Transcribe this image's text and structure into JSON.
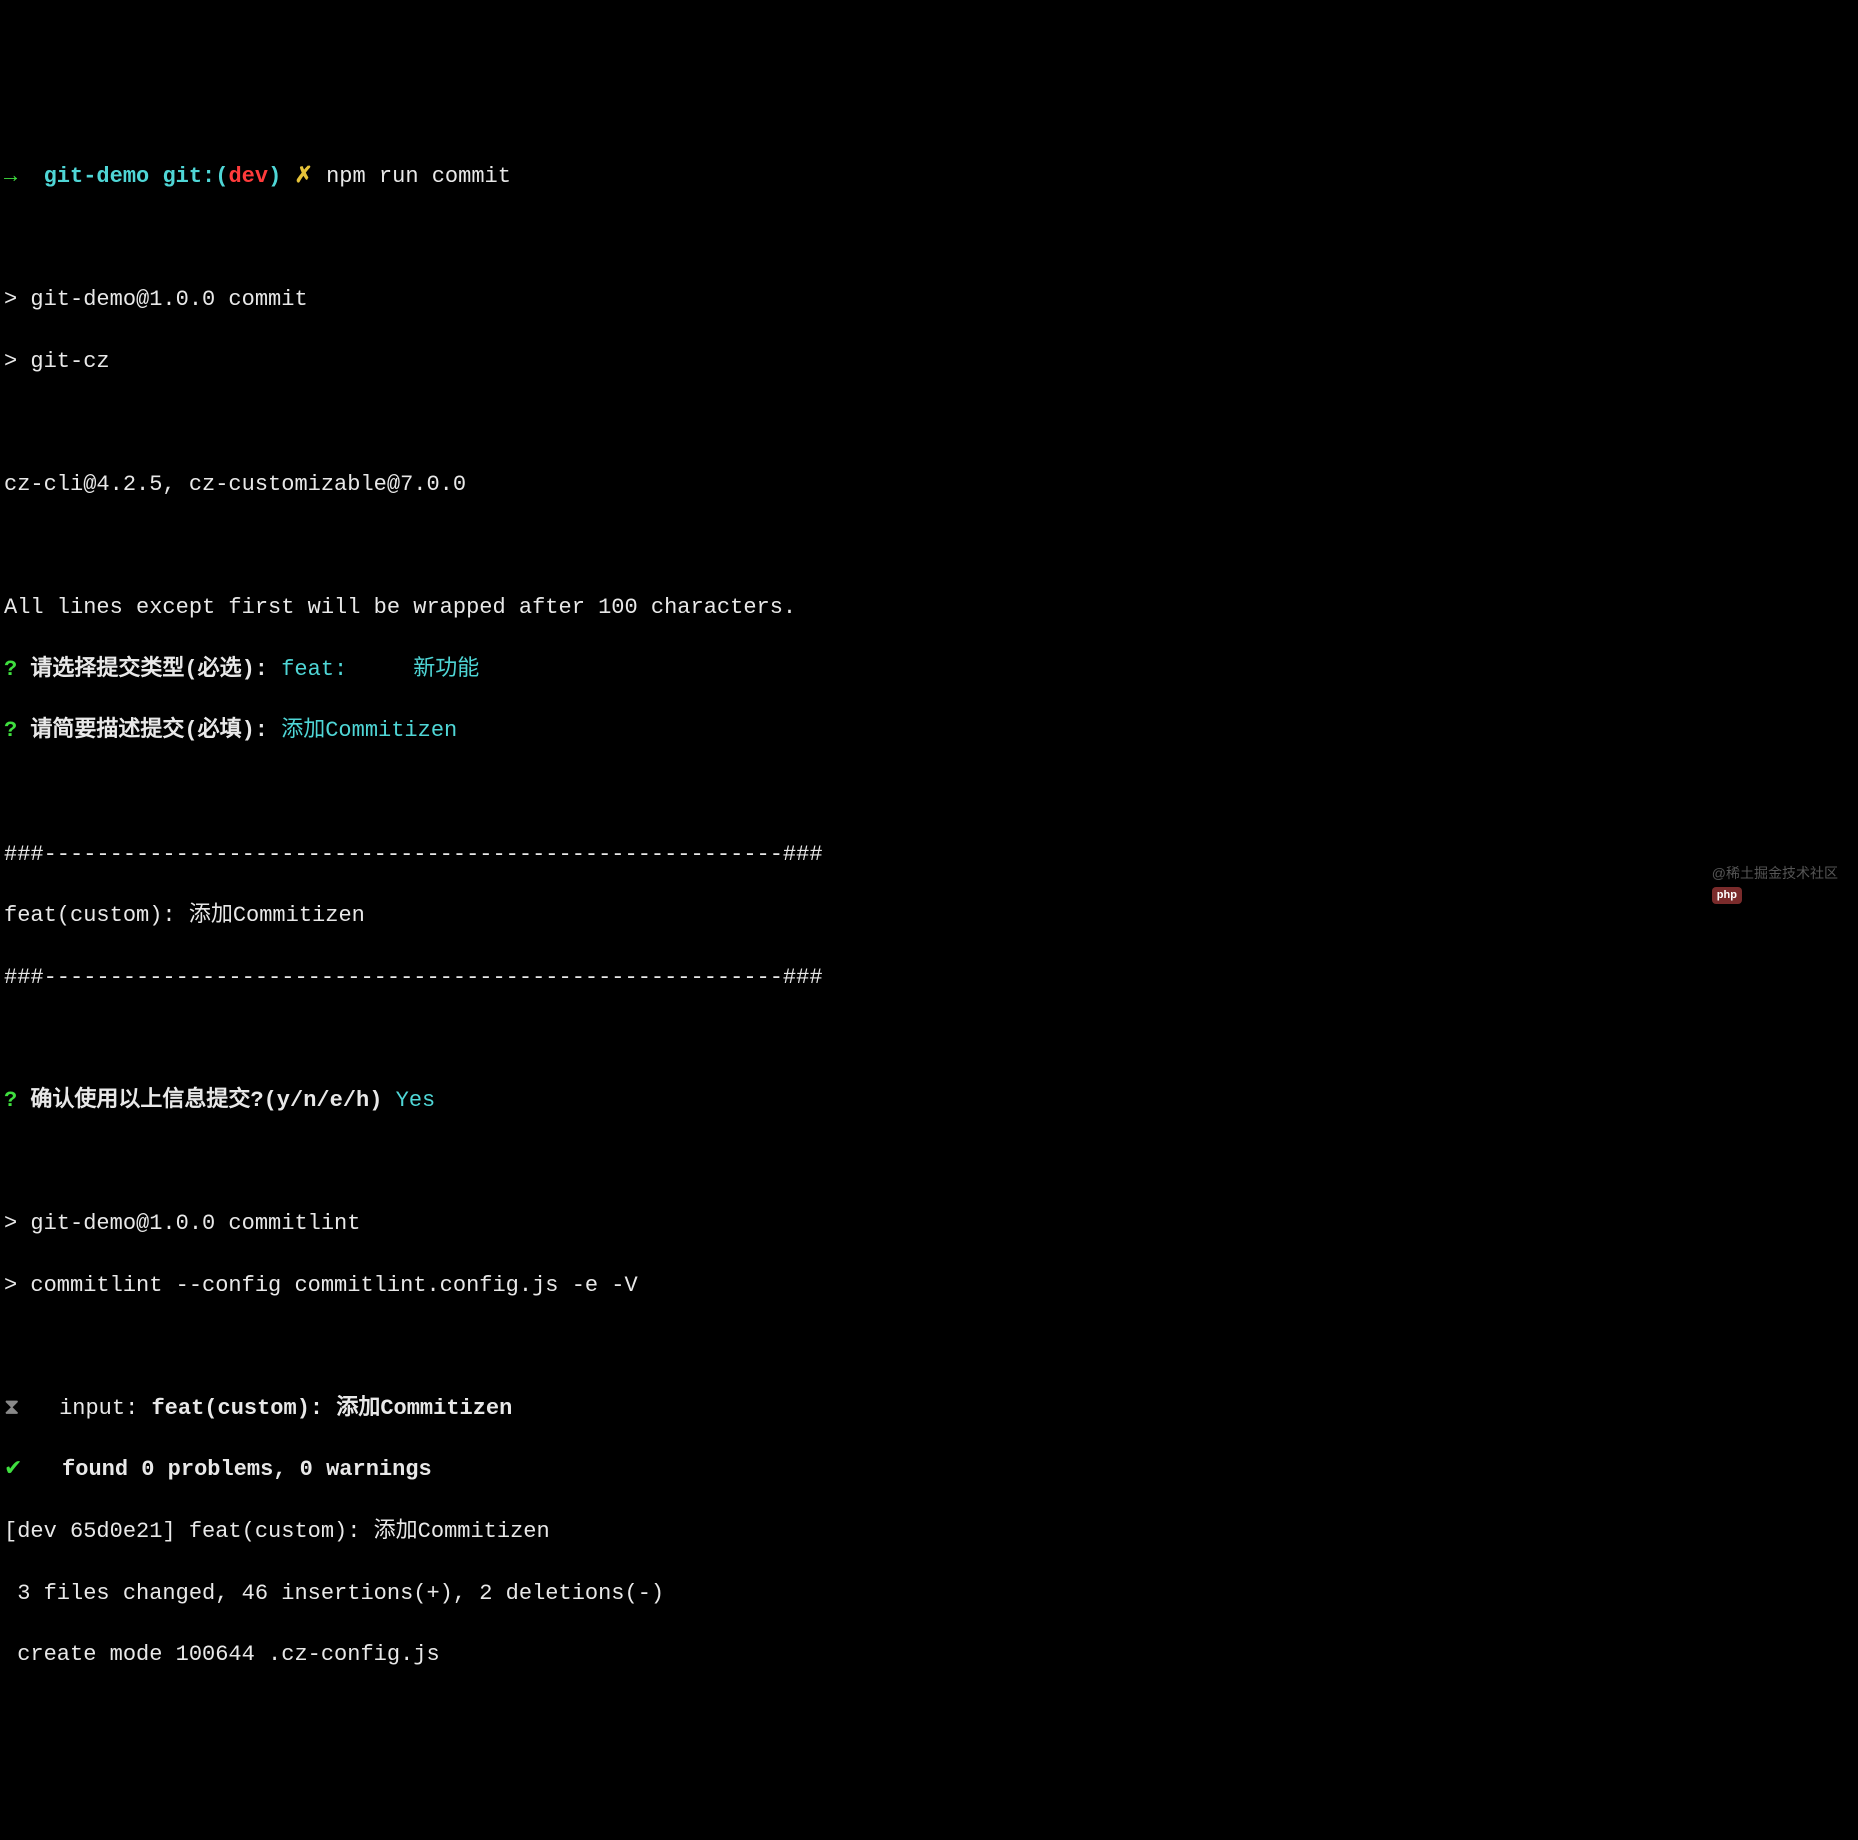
{
  "prompt": {
    "arrow": "→",
    "dir": "git-demo",
    "git_label": "git:(",
    "branch": "dev",
    "git_close": ")",
    "dirty": "✗",
    "command": "npm run commit"
  },
  "script1": {
    "line1": "> git-demo@1.0.0 commit",
    "line2": "> git-cz"
  },
  "czcli": "cz-cli@4.2.5, cz-customizable@7.0.0",
  "wrap_msg": "All lines except first will be wrapped after 100 characters.",
  "q1": {
    "mark": "?",
    "prompt": "请选择提交类型(必选):",
    "answer1": "feat:",
    "answer2": "新功能"
  },
  "q2": {
    "mark": "?",
    "prompt": "请简要描述提交(必填):",
    "answer": "添加Commitizen"
  },
  "divider1": "###--------------------------------------------------------###",
  "commit_msg": "feat(custom): 添加Commitizen",
  "divider2": "###--------------------------------------------------------###",
  "q3": {
    "mark": "?",
    "prompt": "确认使用以上信息提交?(y/n/e/h)",
    "answer": "Yes"
  },
  "script2": {
    "line1": "> git-demo@1.0.0 commitlint",
    "line2": "> commitlint --config commitlint.config.js -e -V"
  },
  "lint": {
    "x_icon": "⧗",
    "input_label": "input:",
    "input_value": "feat(custom): 添加Commitizen",
    "check_icon": "✔",
    "found": "found 0 problems, 0 warnings"
  },
  "git_result": {
    "line1": "[dev 65d0e21] feat(custom): 添加Commitizen",
    "line2": " 3 files changed, 46 insertions(+), 2 deletions(-)",
    "line3": " create mode 100644 .cz-config.js"
  },
  "watermark": {
    "text": "@稀土掘金技术社区",
    "php": "php"
  }
}
